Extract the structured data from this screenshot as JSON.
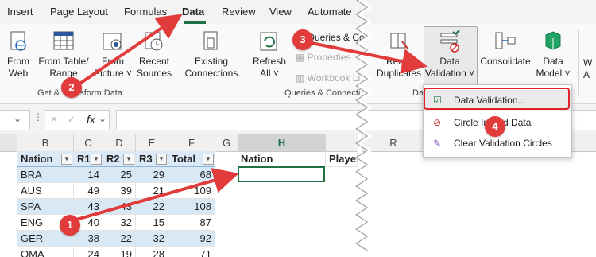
{
  "tabs": [
    "Insert",
    "Page Layout",
    "Formulas",
    "Data",
    "Review",
    "View",
    "Automate"
  ],
  "ribbon": {
    "from_web": [
      "From",
      "Web"
    ],
    "from_table": [
      "From Table/",
      "Range"
    ],
    "from_picture": [
      "From",
      "Picture ˅"
    ],
    "recent_sources": [
      "Recent",
      "Sources"
    ],
    "existing_connections": [
      "Existing",
      "Connections"
    ],
    "refresh_all": [
      "Refresh",
      "All ˅"
    ],
    "queries_connections": "Queries & Co",
    "properties": "Properties",
    "workbook_links": "Workbook Li",
    "remove_duplicates": [
      "Remo",
      "Duplicates"
    ],
    "data_validation": [
      "Data",
      "Validation ˅"
    ],
    "consolidate": "Consolidate",
    "data_model": [
      "Data",
      "Model ˅"
    ],
    "edge_letters": [
      "W",
      "A"
    ],
    "group_get_transform": "Get & Transform Data",
    "group_queries": "Queries & Connecti",
    "group_data_tools": "Da"
  },
  "formula_bar": {
    "fx": "fx",
    "chevron": "⋮",
    "down": "⌄"
  },
  "grid": {
    "columns": [
      "B",
      "C",
      "D",
      "E",
      "F",
      "G",
      "H",
      "R"
    ],
    "headers": [
      "Nation",
      "R1",
      "R2",
      "R3",
      "Total"
    ],
    "h_header": "Nation",
    "i_header": "Players",
    "rows": [
      [
        "BRA",
        "14",
        "25",
        "29",
        "68"
      ],
      [
        "AUS",
        "49",
        "39",
        "21",
        "109"
      ],
      [
        "SPA",
        "43",
        "43",
        "22",
        "108"
      ],
      [
        "ENG",
        "40",
        "32",
        "15",
        "87"
      ],
      [
        "GER",
        "38",
        "22",
        "32",
        "92"
      ],
      [
        "OMA",
        "24",
        "19",
        "28",
        "71"
      ]
    ]
  },
  "dropdown": {
    "items": [
      "Data Validation...",
      "Circle Invalid Data",
      "Clear Validation Circles"
    ]
  },
  "callouts": [
    "1",
    "2",
    "3",
    "4"
  ],
  "colors": {
    "accent": "#1e7145",
    "callout": "#e23b3b"
  }
}
